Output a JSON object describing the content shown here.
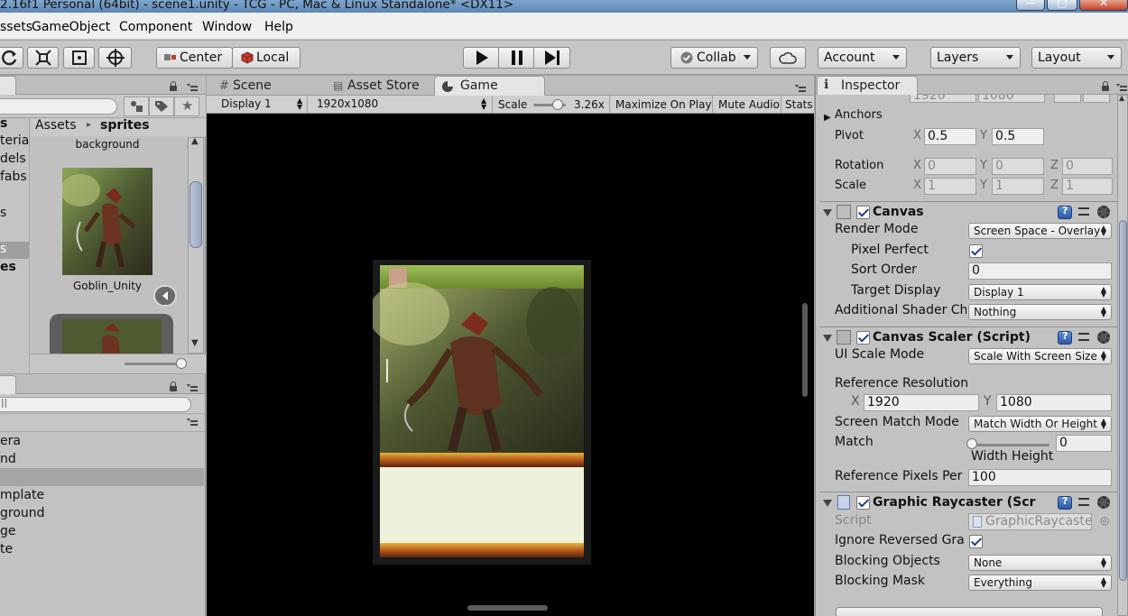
{
  "window": {
    "title": "2.16f1 Personal (64bit) - scene1.unity - TCG - PC, Mac & Linux Standalone* <DX11>"
  },
  "menu": {
    "items": [
      "ssets",
      "GameObject",
      "Component",
      "Window",
      "Help"
    ]
  },
  "toolbar": {
    "pivot_center": "Center",
    "pivot_local": "Local",
    "collab": "Collab",
    "account": "Account",
    "layers": "Layers",
    "layout": "Layout"
  },
  "project": {
    "breadcrumb_root": "Assets",
    "breadcrumb_current": "sprites",
    "left_label": "s",
    "folders": [
      "terials",
      "dels",
      "fabs",
      "",
      "s",
      "s",
      "es"
    ],
    "assets": [
      {
        "name": "background"
      },
      {
        "name": "Goblin_Unity"
      }
    ]
  },
  "hierarchy": {
    "search_placeholder": "ll",
    "items": [
      "era",
      "nd",
      "",
      "mplate",
      "ground",
      "ge",
      "te"
    ]
  },
  "tabs": {
    "scene": "Scene",
    "asset_store": "Asset Store",
    "game": "Game"
  },
  "game": {
    "display": "Display 1",
    "resolution": "1920x1080",
    "scale_label": "Scale",
    "scale_value": "3.26x",
    "maximize": "Maximize On Play",
    "mute": "Mute Audio",
    "stats": "Stats"
  },
  "inspector": {
    "tab": "Inspector",
    "top_w": "1920",
    "top_h": "1080",
    "anchors": "Anchors",
    "pivot": {
      "label": "Pivot",
      "x": "0.5",
      "y": "0.5"
    },
    "rotation": {
      "label": "Rotation",
      "x": "0",
      "y": "0",
      "z": "0"
    },
    "scale": {
      "label": "Scale",
      "x": "1",
      "y": "1",
      "z": "1"
    },
    "axis": {
      "x": "X",
      "y": "Y",
      "z": "Z"
    },
    "canvas": {
      "title": "Canvas",
      "render_mode_label": "Render Mode",
      "render_mode": "Screen Space - Overlay",
      "pixel_perfect_label": "Pixel Perfect",
      "sort_order_label": "Sort Order",
      "sort_order": "0",
      "target_display_label": "Target Display",
      "target_display": "Display 1",
      "shader_label": "Additional Shader Ch",
      "shader": "Nothing"
    },
    "scaler": {
      "title": "Canvas Scaler (Script)",
      "ui_scale_label": "UI Scale Mode",
      "ui_scale": "Scale With Screen Size",
      "ref_res_label": "Reference Resolution",
      "ref_x": "1920",
      "ref_y": "1080",
      "match_mode_label": "Screen Match Mode",
      "match_mode": "Match Width Or Height",
      "match_label": "Match",
      "match_value": "0",
      "match_fraction": 0,
      "width": "Width",
      "height": "Height",
      "ref_px_label": "Reference Pixels Per",
      "ref_px": "100"
    },
    "raycaster": {
      "title": "Graphic Raycaster (Scr",
      "script_label": "Script",
      "script": "GraphicRaycaste",
      "ignore_label": "Ignore Reversed Gra",
      "blocking_objects_label": "Blocking Objects",
      "blocking_objects": "None",
      "blocking_mask_label": "Blocking Mask",
      "blocking_mask": "Everything"
    }
  },
  "colors": {
    "accent": "#5c86b4",
    "panel": "#c2c2c2",
    "game_bg": "#000000"
  }
}
